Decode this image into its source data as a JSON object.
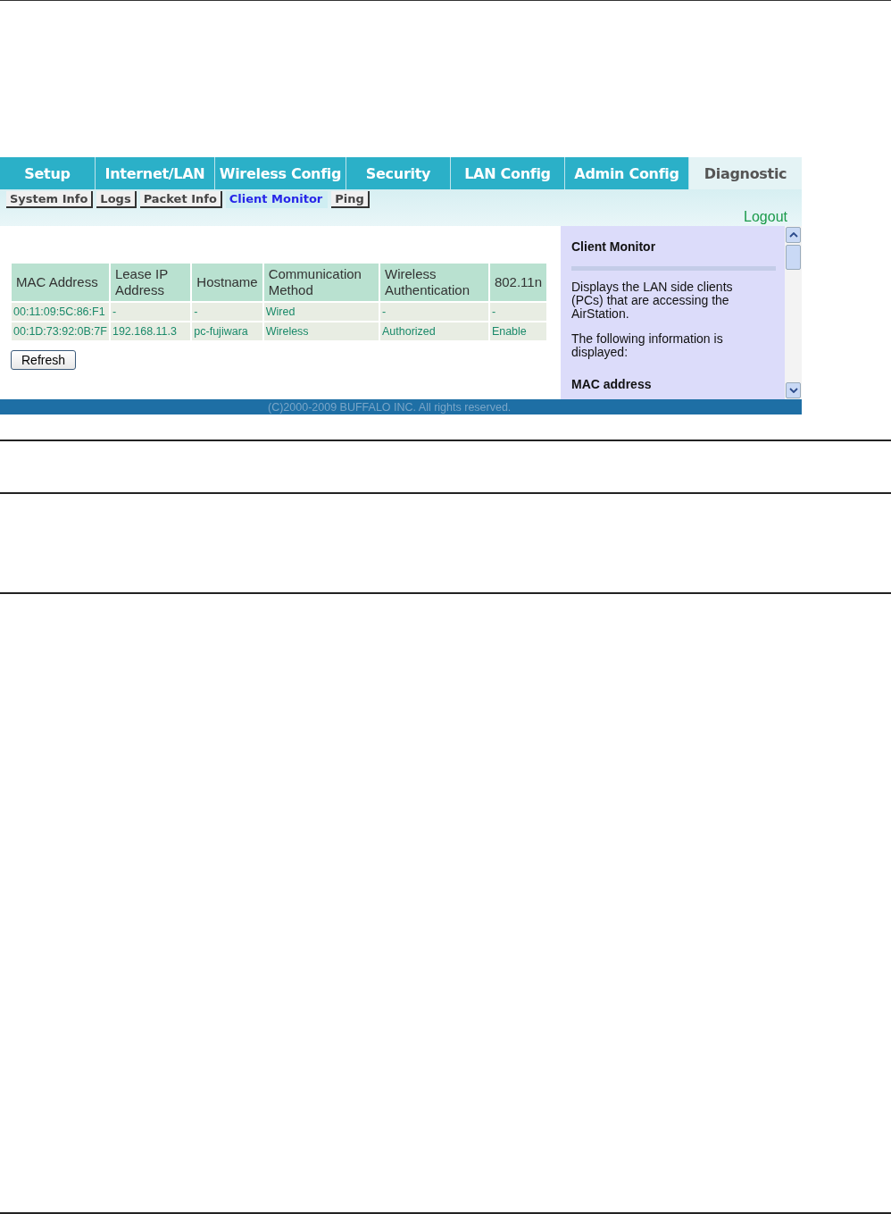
{
  "tabs": [
    {
      "label": "Setup",
      "selected": false
    },
    {
      "label": "Internet/LAN",
      "selected": false
    },
    {
      "label": "Wireless Config",
      "selected": false
    },
    {
      "label": "Security",
      "selected": false
    },
    {
      "label": "LAN Config",
      "selected": false
    },
    {
      "label": "Admin Config",
      "selected": false
    },
    {
      "label": "Diagnostic",
      "selected": true
    }
  ],
  "subtabs": [
    {
      "label": "System Info",
      "selected": false
    },
    {
      "label": "Logs",
      "selected": false
    },
    {
      "label": "Packet Info",
      "selected": false
    },
    {
      "label": "Client Monitor",
      "selected": true
    },
    {
      "label": "Ping",
      "selected": false
    }
  ],
  "logout": "Logout",
  "table": {
    "columns": [
      "MAC Address",
      "Lease IP Address",
      "Hostname",
      "Communication Method",
      "Wireless Authentication",
      "802.11n"
    ],
    "rows": [
      [
        "00:11:09:5C:86:F1",
        "-",
        "-",
        "Wired",
        "-",
        "-"
      ],
      [
        "00:1D:73:92:0B:7F",
        "192.168.11.3",
        "pc-fujiwara",
        "Wireless",
        "Authorized",
        "Enable"
      ]
    ]
  },
  "refresh_button": "Refresh",
  "help": {
    "title": "Client Monitor",
    "paragraphs": [
      "Displays the LAN side clients (PCs) that are accessing the AirStation.",
      "The following information is displayed:"
    ],
    "heading": "MAC address"
  },
  "footer": "(C)2000-2009 BUFFALO INC. All rights reserved."
}
